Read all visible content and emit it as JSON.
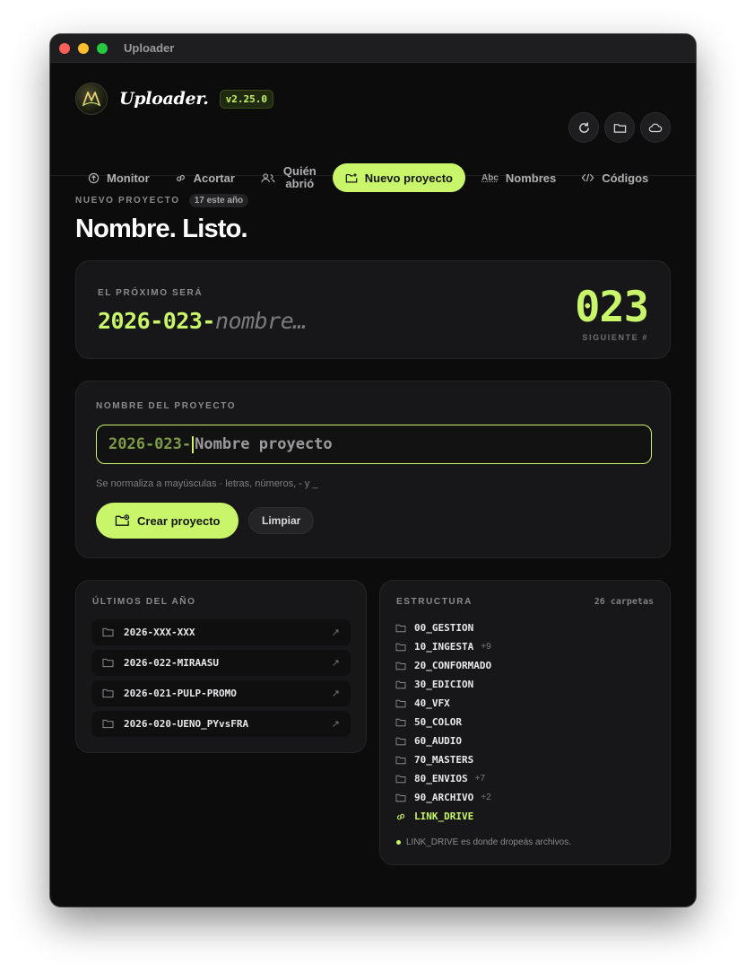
{
  "window": {
    "title": "Uploader",
    "traffic_lights": {
      "close": "#ff5f57",
      "minimize": "#febc2e",
      "zoom": "#28c840"
    }
  },
  "brand": {
    "name": "Uploader.",
    "version": "v2.25.0",
    "accent": "#c8f56a"
  },
  "header_actions": [
    "refresh-icon",
    "folder-icon",
    "cloud-icon"
  ],
  "nav": [
    {
      "label": "Monitor",
      "icon": "upload-circle-icon",
      "active": false
    },
    {
      "label": "Acortar",
      "icon": "link-icon",
      "active": false
    },
    {
      "label_line1": "Quién",
      "label_line2": "abrió",
      "icon": "users-icon",
      "active": false
    },
    {
      "label": "Nuevo proyecto",
      "icon": "folder-plus-icon",
      "active": true
    },
    {
      "label": "Nombres",
      "icon_text": "Abc",
      "icon": "abc-icon",
      "active": false
    },
    {
      "label": "Códigos",
      "icon": "code-icon",
      "active": false
    }
  ],
  "page": {
    "eyebrow": "NUEVO PROYECTO",
    "count": "17 este año",
    "title": "Nombre. Listo."
  },
  "next": {
    "label": "EL PRÓXIMO SERÁ",
    "prefix": "2026-023-",
    "placeholder": "nombre…",
    "number": "023",
    "sublabel": "SIGUIENTE #"
  },
  "form": {
    "label": "NOMBRE DEL PROYECTO",
    "prefix": "2026-023-",
    "placeholder": "Nombre proyecto",
    "hint": "Se normaliza a mayúsculas · letras, números, - y _",
    "create_label": "Crear proyecto",
    "clear_label": "Limpiar"
  },
  "recent": {
    "label": "ÚLTIMOS DEL AÑO",
    "items": [
      {
        "name": "2026-XXX-XXX"
      },
      {
        "name": "2026-022-MIRAASU"
      },
      {
        "name": "2026-021-PULP-PROMO"
      },
      {
        "name": "2026-020-UENO_PYvsFRA"
      }
    ]
  },
  "structure": {
    "label": "ESTRUCTURA",
    "meta": "26 carpetas",
    "folders": [
      {
        "name": "00_GESTION",
        "extra": ""
      },
      {
        "name": "10_INGESTA",
        "extra": "+9"
      },
      {
        "name": "20_CONFORMADO",
        "extra": ""
      },
      {
        "name": "30_EDICION",
        "extra": ""
      },
      {
        "name": "40_VFX",
        "extra": ""
      },
      {
        "name": "50_COLOR",
        "extra": ""
      },
      {
        "name": "60_AUDIO",
        "extra": ""
      },
      {
        "name": "70_MASTERS",
        "extra": ""
      },
      {
        "name": "80_ENVIOS",
        "extra": "+7"
      },
      {
        "name": "90_ARCHIVO",
        "extra": "+2"
      }
    ],
    "link": "LINK_DRIVE",
    "note": "LINK_DRIVE es donde dropeás archivos."
  }
}
